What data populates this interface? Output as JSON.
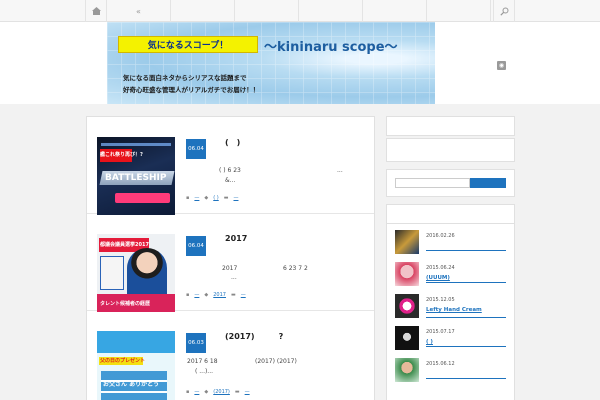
{
  "nav": {
    "arrow": "«"
  },
  "header": {
    "banner_jp": "気になるスコープ！",
    "banner_en": "～kininaru scope～",
    "banner_line1": "気になる面白ネタからシリアスな話題まで",
    "banner_line2": "好奇心旺盛な管理人がリアルガチでお届け！！"
  },
  "posts": [
    {
      "date": "06.04",
      "title": "(　)",
      "excerpt_a": "(   ) 6 23",
      "excerpt_b": "...",
      "excerpt_c": "&...",
      "cat": "(   )",
      "tag": "—",
      "thumb_text_1": "BATTLESHIP",
      "thumb_text_2": "艦これ祭り再び！?"
    },
    {
      "date": "06.04",
      "title": "2017",
      "excerpt_a": "2017",
      "excerpt_b": "6 23   7 2",
      "excerpt_c": "...",
      "cat": "2017",
      "tag": "—",
      "thumb_text_1": "都議会議員選挙2017",
      "thumb_text_2": "タレント候補者の経歴"
    },
    {
      "date": "06.03",
      "title": "(2017)　　　?",
      "excerpt_a": "2017    6 18",
      "excerpt_b": "(2017)     (2017)",
      "excerpt_c": "(    ...)...",
      "cat": "(2017)",
      "tag": "—",
      "thumb_text_1": "父の日のプレゼント",
      "thumb_text_2": "お父さん ありがとう"
    }
  ],
  "sidebar": {
    "recent": [
      {
        "date": "2016.02.26",
        "title": ""
      },
      {
        "date": "2015.06.24",
        "title": "(UUUM)"
      },
      {
        "date": "2015.12.05",
        "title": "Lefty Hand Cream"
      },
      {
        "date": "2015.07.17",
        "title": "(   )"
      },
      {
        "date": "2015.06.12",
        "title": ""
      }
    ]
  }
}
